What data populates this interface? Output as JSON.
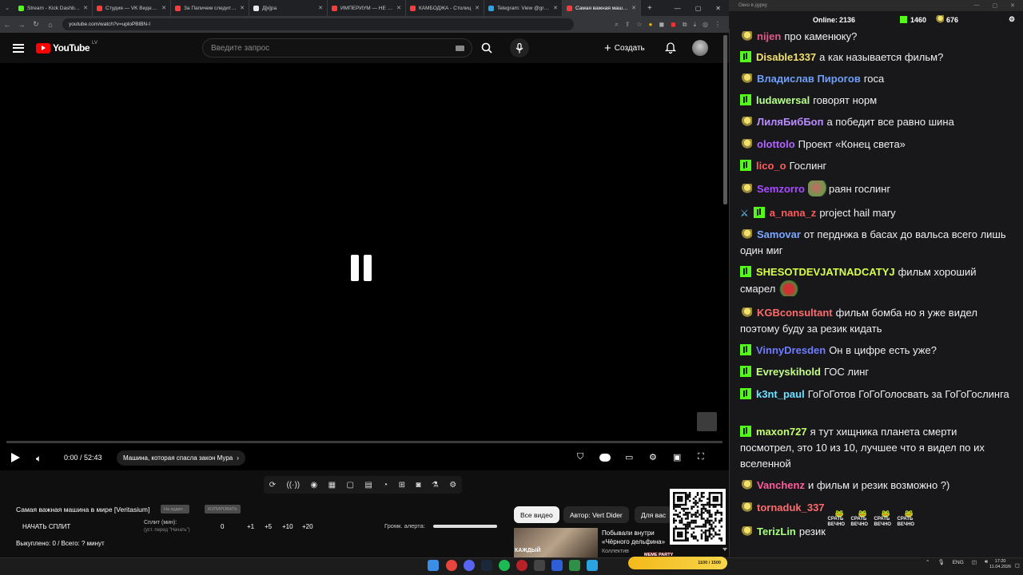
{
  "browser": {
    "tabs": [
      {
        "title": "Stream - Kick Dashboa",
        "color": "#53fc18"
      },
      {
        "title": "Студия — VK Видео (L",
        "color": "#ff3b3b"
      },
      {
        "title": "За Пaпичем следит в р",
        "color": "#ff3b3b"
      },
      {
        "title": "Д[к]ра",
        "color": "#e8e8e8"
      },
      {
        "title": "ИМПЕРИУМ — НЕ РС",
        "color": "#ff3b3b"
      },
      {
        "title": "КАМБОДЖА - Столиц",
        "color": "#ff3b3b"
      },
      {
        "title": "Telegram: View @groks",
        "color": "#2aa3e0"
      },
      {
        "title": "Самая важная машина",
        "color": "#ff3b3b"
      }
    ],
    "url": "youtube.com/watch?v=uploPBlBN-I"
  },
  "youtube": {
    "logo": "YouTube",
    "region": "LV",
    "search_placeholder": "Введите запрос",
    "create_label": "Создать",
    "time": "0:00 / 52:43",
    "chapter": "Машина, которая спасла закон Мура",
    "video_title": "Самая важная машина в мире [Veritasium]",
    "btn_all": "На аудио...",
    "btn_copy": "КОПИРОВАТЬ",
    "start_split": "НАЧАТЬ СПЛИТ",
    "split_label": "Сплит (мин):",
    "split_hint": "(уст. перед \"Начать\")",
    "split_values": [
      "0",
      "+1",
      "+5",
      "+10",
      "+20"
    ],
    "alert_label": "Громк. алерта:",
    "bought": "Выкуплено: 0 / Всего: ? минут",
    "chips": [
      "Все видео",
      "Автор: Vert Dider",
      "Для вас"
    ],
    "rec_title": "Побывали внутри «Чёрного дельфина»",
    "rec_channel": "Коллектив",
    "rec_thumb_text": "КАЖДЫЙ"
  },
  "taskbar": {
    "meme_label": "MEME PARTY",
    "meme_progress": "1100 / 1500",
    "lang": "ENG",
    "time": "17:20",
    "date": "11.04.2026"
  },
  "chat": {
    "window_title": "Окно в дурку",
    "online_label": "Online:",
    "online": "2136",
    "kick_count": "1460",
    "sub_count": "676",
    "messages": [
      {
        "user": "nijen",
        "color": "#e05a8a",
        "text": "про каменюку?",
        "badge": "sub"
      },
      {
        "user": "Disable1337",
        "color": "#f1e06b",
        "text": "а как называется фильм?",
        "badge": "kick"
      },
      {
        "user": "Владислав Пирогов",
        "color": "#6f9ff7",
        "text": "госа",
        "badge": "sub"
      },
      {
        "user": "ludawersal",
        "color": "#b6ff8a",
        "text": "говорят норм",
        "badge": "kick"
      },
      {
        "user": "ЛиляБибБоп",
        "color": "#b98cff",
        "text": "а победит все равно шина",
        "badge": "sub"
      },
      {
        "user": "olottolo",
        "color": "#b065ff",
        "text": "Проект «Конец света»",
        "badge": "sub"
      },
      {
        "user": "lico_o",
        "color": "#ff5a5a",
        "text": "Гослинг",
        "badge": "kick"
      },
      {
        "user": "Semzorro",
        "color": "#a64dff",
        "text": "раян гослинг",
        "badge": "sub"
      },
      {
        "user": "a_nana_z",
        "color": "#ff5a5a",
        "text": "project hail mary",
        "badge": "kick"
      },
      {
        "user": "Samovar",
        "color": "#7aa7ff",
        "text": "от перднжа в басах до вальса всего лишь один миг",
        "badge": "sub"
      },
      {
        "user": "SHESOTDEVJATNADCATYJ",
        "color": "#d9ff4a",
        "text": "фильм хороший смарел",
        "badge": "kick"
      },
      {
        "user": "KGBconsultant",
        "color": "#ff6b6b",
        "text": "фильм бомба но я уже видел поэтому буду за резик кидать",
        "badge": "sub"
      },
      {
        "user": "VinnyDresden",
        "color": "#6f7cff",
        "text": "Он в цифре есть уже?",
        "badge": "kick"
      },
      {
        "user": "Evreyskihold",
        "color": "#c4ff86",
        "text": "ГОС линг",
        "badge": "kick"
      },
      {
        "user": "k3nt_paul",
        "color": "#6fe0ff",
        "text": "ГоГоГотов ГоГоГолосвать за ГоГоГослинга",
        "badge": "kick"
      },
      {
        "user": "maxon727",
        "color": "#c4ff6a",
        "text": "я тут хищника планета смерти посмотрел, это 10 из 10, лучшее что я видел по их вселенной",
        "badge": "kick"
      },
      {
        "user": "Vanchenz",
        "color": "#ff5c9a",
        "text": "и фильм и резик возможно ?)",
        "badge": "sub"
      },
      {
        "user": "tornaduk_337",
        "color": "#ff6b6b",
        "text": "",
        "badge": "sub"
      },
      {
        "user": "TerizLin",
        "color": "#a6ff7a",
        "text": "резик",
        "badge": "sub"
      }
    ],
    "emote_text": "СРАТЬ ВЕЧНО"
  }
}
